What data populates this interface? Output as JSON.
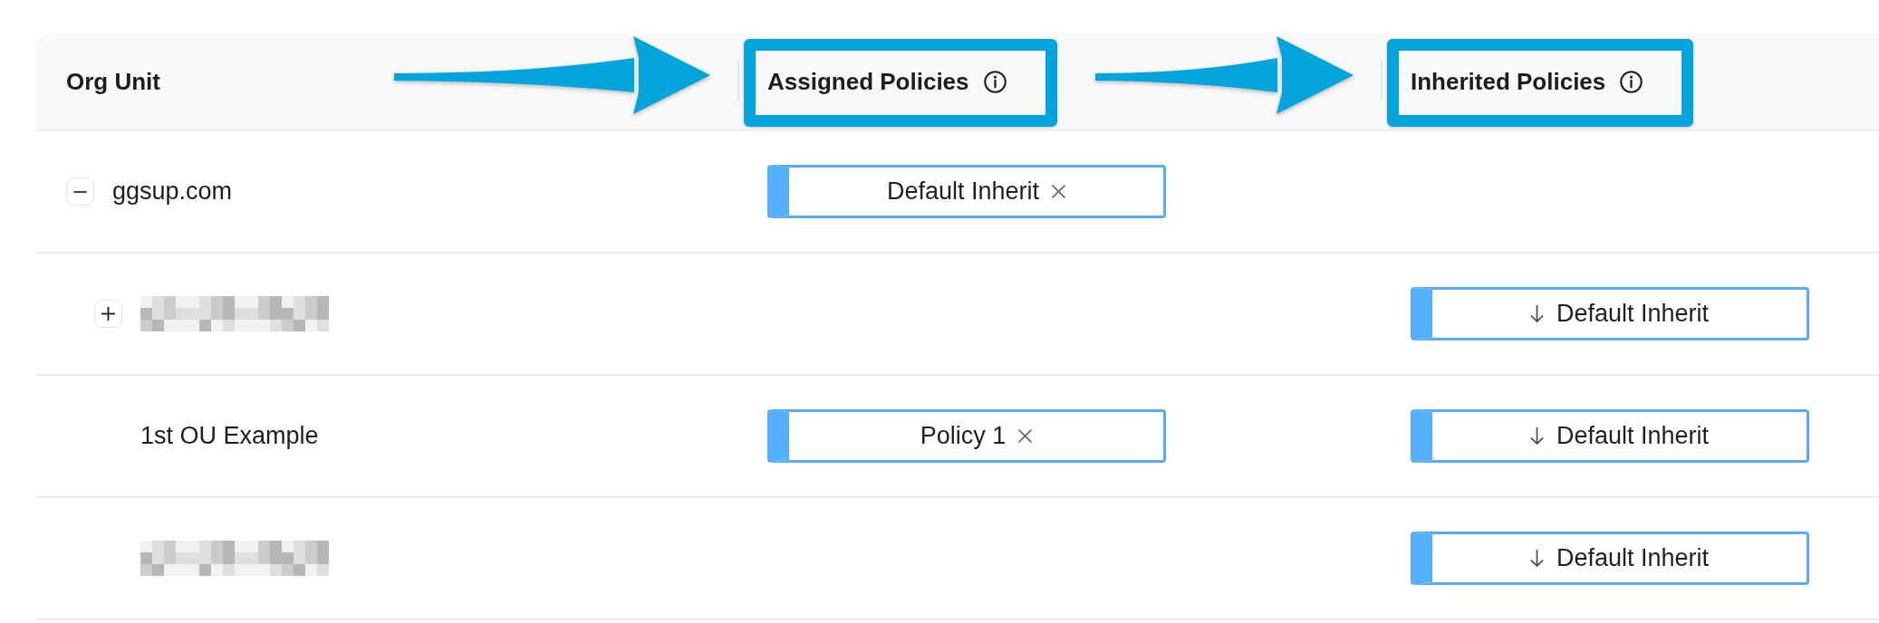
{
  "table": {
    "columns": [
      {
        "label": "Org Unit",
        "info": false,
        "highlighted": false
      },
      {
        "label": "Assigned Policies",
        "info": true,
        "highlighted": true
      },
      {
        "label": "Inherited Policies",
        "info": true,
        "highlighted": true
      }
    ],
    "rows": [
      {
        "label": "ggsup.com",
        "redacted": false,
        "expanded": true,
        "assigned_policies": [
          {
            "label": "Default Inherit",
            "removable": true
          }
        ],
        "children": [
          {
            "redacted": true,
            "expanded": false,
            "inherited_policies": [
              {
                "label": "Default Inherit"
              }
            ]
          },
          {
            "label": "1st OU Example",
            "redacted": false,
            "assigned_policies": [
              {
                "label": "Policy 1",
                "removable": true
              }
            ],
            "inherited_policies": [
              {
                "label": "Default Inherit"
              }
            ]
          },
          {
            "redacted": true,
            "inherited_policies": [
              {
                "label": "Default Inherit"
              }
            ]
          }
        ]
      }
    ]
  }
}
